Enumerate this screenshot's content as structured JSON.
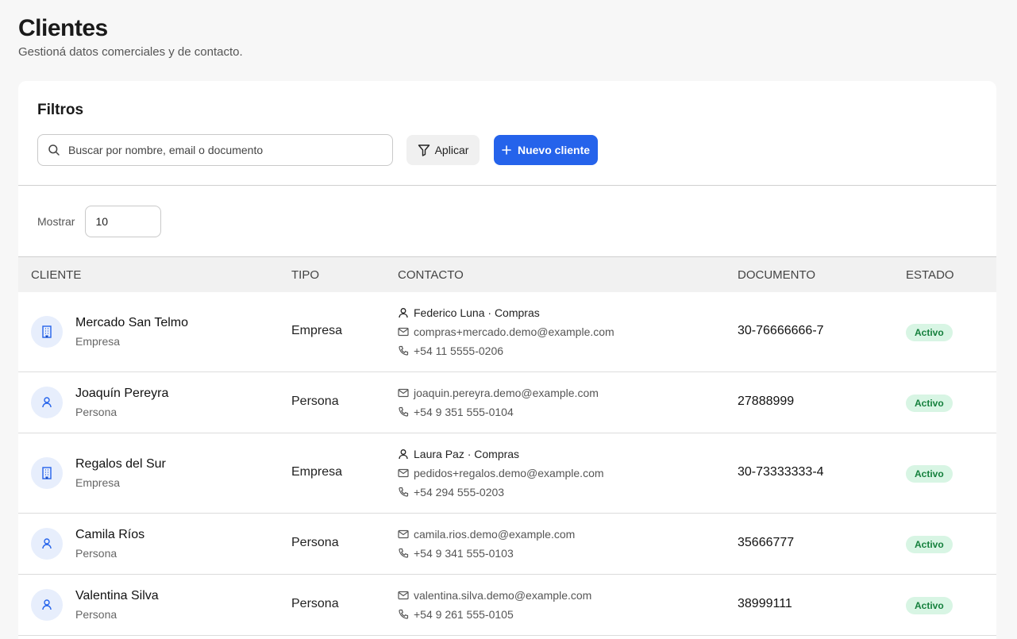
{
  "header": {
    "title": "Clientes",
    "subtitle": "Gestioná datos comerciales y de contacto."
  },
  "filters": {
    "title": "Filtros",
    "search_placeholder": "Buscar por nombre, email o documento",
    "search_value": "",
    "apply_label": "Aplicar",
    "new_label": "Nuevo cliente"
  },
  "pagination": {
    "show_label": "Mostrar",
    "show_value": "10"
  },
  "table": {
    "columns": [
      "CLIENTE",
      "TIPO",
      "CONTACTO",
      "DOCUMENTO",
      "ESTADO"
    ],
    "rows": [
      {
        "name": "Mercado San Telmo",
        "sub": "Empresa",
        "type": "Empresa",
        "icon": "building-icon",
        "contact_person": "Federico Luna · Compras",
        "email": "compras+mercado.demo@example.com",
        "phone": "+54 11 5555-0206",
        "document": "30-76666666-7",
        "status": "Activo"
      },
      {
        "name": "Joaquín Pereyra",
        "sub": "Persona",
        "type": "Persona",
        "icon": "person-icon",
        "email": "joaquin.pereyra.demo@example.com",
        "phone": "+54 9 351 555-0104",
        "document": "27888999",
        "status": "Activo"
      },
      {
        "name": "Regalos del Sur",
        "sub": "Empresa",
        "type": "Empresa",
        "icon": "building-icon",
        "contact_person": "Laura Paz · Compras",
        "email": "pedidos+regalos.demo@example.com",
        "phone": "+54 294 555-0203",
        "document": "30-73333333-4",
        "status": "Activo"
      },
      {
        "name": "Camila Ríos",
        "sub": "Persona",
        "type": "Persona",
        "icon": "person-icon",
        "email": "camila.rios.demo@example.com",
        "phone": "+54 9 341 555-0103",
        "document": "35666777",
        "status": "Activo"
      },
      {
        "name": "Valentina Silva",
        "sub": "Persona",
        "type": "Persona",
        "icon": "person-icon",
        "email": "valentina.silva.demo@example.com",
        "phone": "+54 9 261 555-0105",
        "document": "38999111",
        "status": "Activo"
      }
    ]
  },
  "colors": {
    "accent": "#2563eb",
    "badge_bg": "#d8f5e4",
    "badge_text": "#15803d",
    "avatar_bg": "#e7eefc"
  }
}
